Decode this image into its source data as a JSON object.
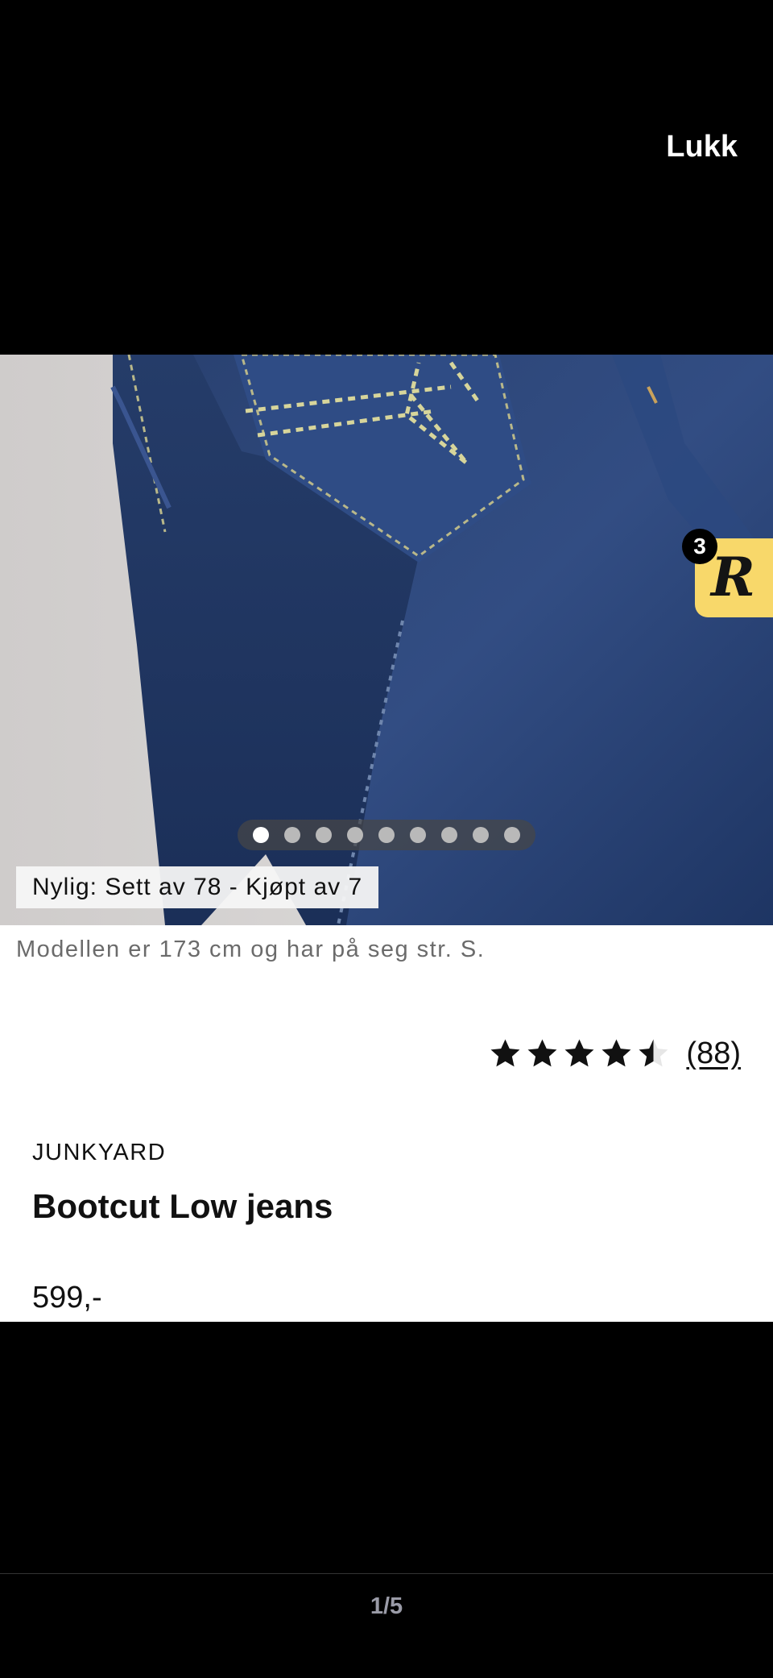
{
  "header": {
    "close_label": "Lukk"
  },
  "gallery": {
    "dot_count": 9,
    "active_dot_index": 0,
    "image_alt": "jeans-back-pocket-photo",
    "seen_badge": "Nylig: Sett av 78 - Kjøpt av 7"
  },
  "reward_badge": {
    "letter": "R",
    "count": "3",
    "color": "#f8d86a"
  },
  "product": {
    "model_info": "Modellen er 173 cm og har på seg str. S.",
    "rating_value": 4.5,
    "rating_max": 5,
    "review_count": "(88)",
    "brand": "JUNKYARD",
    "name": "Bootcut Low jeans",
    "price": "599,-"
  },
  "footer": {
    "counter": "1/5"
  }
}
